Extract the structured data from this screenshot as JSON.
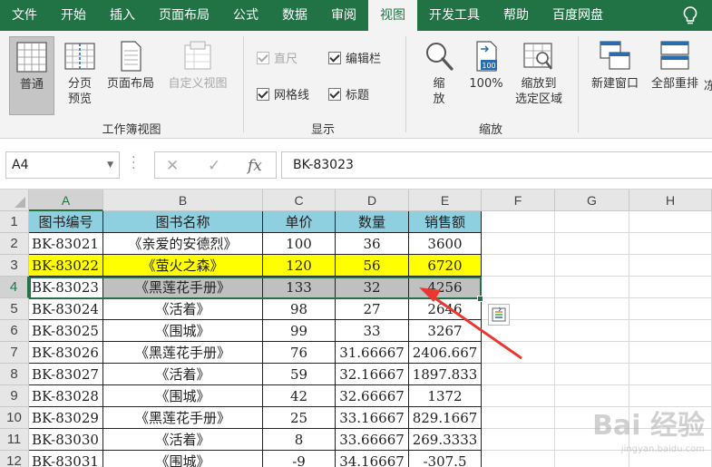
{
  "ribbon": {
    "tabs": [
      "文件",
      "开始",
      "插入",
      "页面布局",
      "公式",
      "数据",
      "审阅",
      "视图",
      "开发工具",
      "帮助",
      "百度网盘"
    ],
    "active_tab": "视图",
    "groups": {
      "workbook_views": {
        "label": "工作簿视图",
        "normal": "普通",
        "page_break_line1": "分页",
        "page_break_line2": "预览",
        "page_layout": "页面布局",
        "custom_views": "自定义视图"
      },
      "show": {
        "label": "显示",
        "ruler": "直尺",
        "formula_bar": "编辑栏",
        "gridlines": "网格线",
        "headings": "标题"
      },
      "zoom": {
        "label": "缩放",
        "zoom_line1": "缩",
        "zoom_line2": "放",
        "zoom_100": "100%",
        "zoom_sel_line1": "缩放到",
        "zoom_sel_line2": "选定区域"
      },
      "window": {
        "new_window": "新建窗口",
        "arrange_all": "全部重排",
        "cut_off": "冻"
      }
    }
  },
  "formula_bar": {
    "name_box": "A4",
    "cancel": "✕",
    "enter": "✓",
    "fx": "fx",
    "value": "BK-83023"
  },
  "sheet": {
    "columns": [
      "A",
      "B",
      "C",
      "D",
      "E",
      "F",
      "G",
      "H"
    ],
    "row_numbers": [
      "1",
      "2",
      "3",
      "4",
      "5",
      "6",
      "7",
      "8",
      "9",
      "10",
      "11",
      "12"
    ],
    "headers": [
      "图书编号",
      "图书名称",
      "单价",
      "数量",
      "销售额"
    ],
    "rows": [
      [
        "BK-83021",
        "《亲爱的安德烈》",
        "100",
        "36",
        "3600"
      ],
      [
        "BK-83022",
        "《萤火之森》",
        "120",
        "56",
        "6720"
      ],
      [
        "BK-83023",
        "《黑莲花手册》",
        "133",
        "32",
        "4256"
      ],
      [
        "BK-83024",
        "《活着》",
        "98",
        "27",
        "2646"
      ],
      [
        "BK-83025",
        "《围城》",
        "99",
        "33",
        "3267"
      ],
      [
        "BK-83026",
        "《黑莲花手册》",
        "76",
        "31.66667",
        "2406.667"
      ],
      [
        "BK-83027",
        "《活着》",
        "59",
        "32.16667",
        "1897.833"
      ],
      [
        "BK-83028",
        "《围城》",
        "42",
        "32.66667",
        "1372"
      ],
      [
        "BK-83029",
        "《黑莲花手册》",
        "25",
        "33.16667",
        "829.1667"
      ],
      [
        "BK-83030",
        "《活着》",
        "8",
        "33.66667",
        "269.3333"
      ],
      [
        "BK-83031",
        "《围城》",
        "-9",
        "34.16667",
        "-307.5"
      ]
    ],
    "selected_cell": "A4"
  },
  "colors": {
    "accent": "#217346",
    "header_fill": "#8ecfe0",
    "highlight_yellow": "#ffff00",
    "highlight_gray": "#c0c0c0",
    "arrow": "#e8382f"
  },
  "icons": [
    "lightbulb-icon",
    "normal-view-icon",
    "page-break-icon",
    "page-layout-icon",
    "custom-views-icon",
    "zoom-icon",
    "zoom-100-icon",
    "zoom-selection-icon",
    "new-window-icon",
    "arrange-all-icon",
    "quick-analysis-icon"
  ],
  "watermark": {
    "line1": "Bai 经验",
    "line2": "jingyan.baidu.com"
  }
}
